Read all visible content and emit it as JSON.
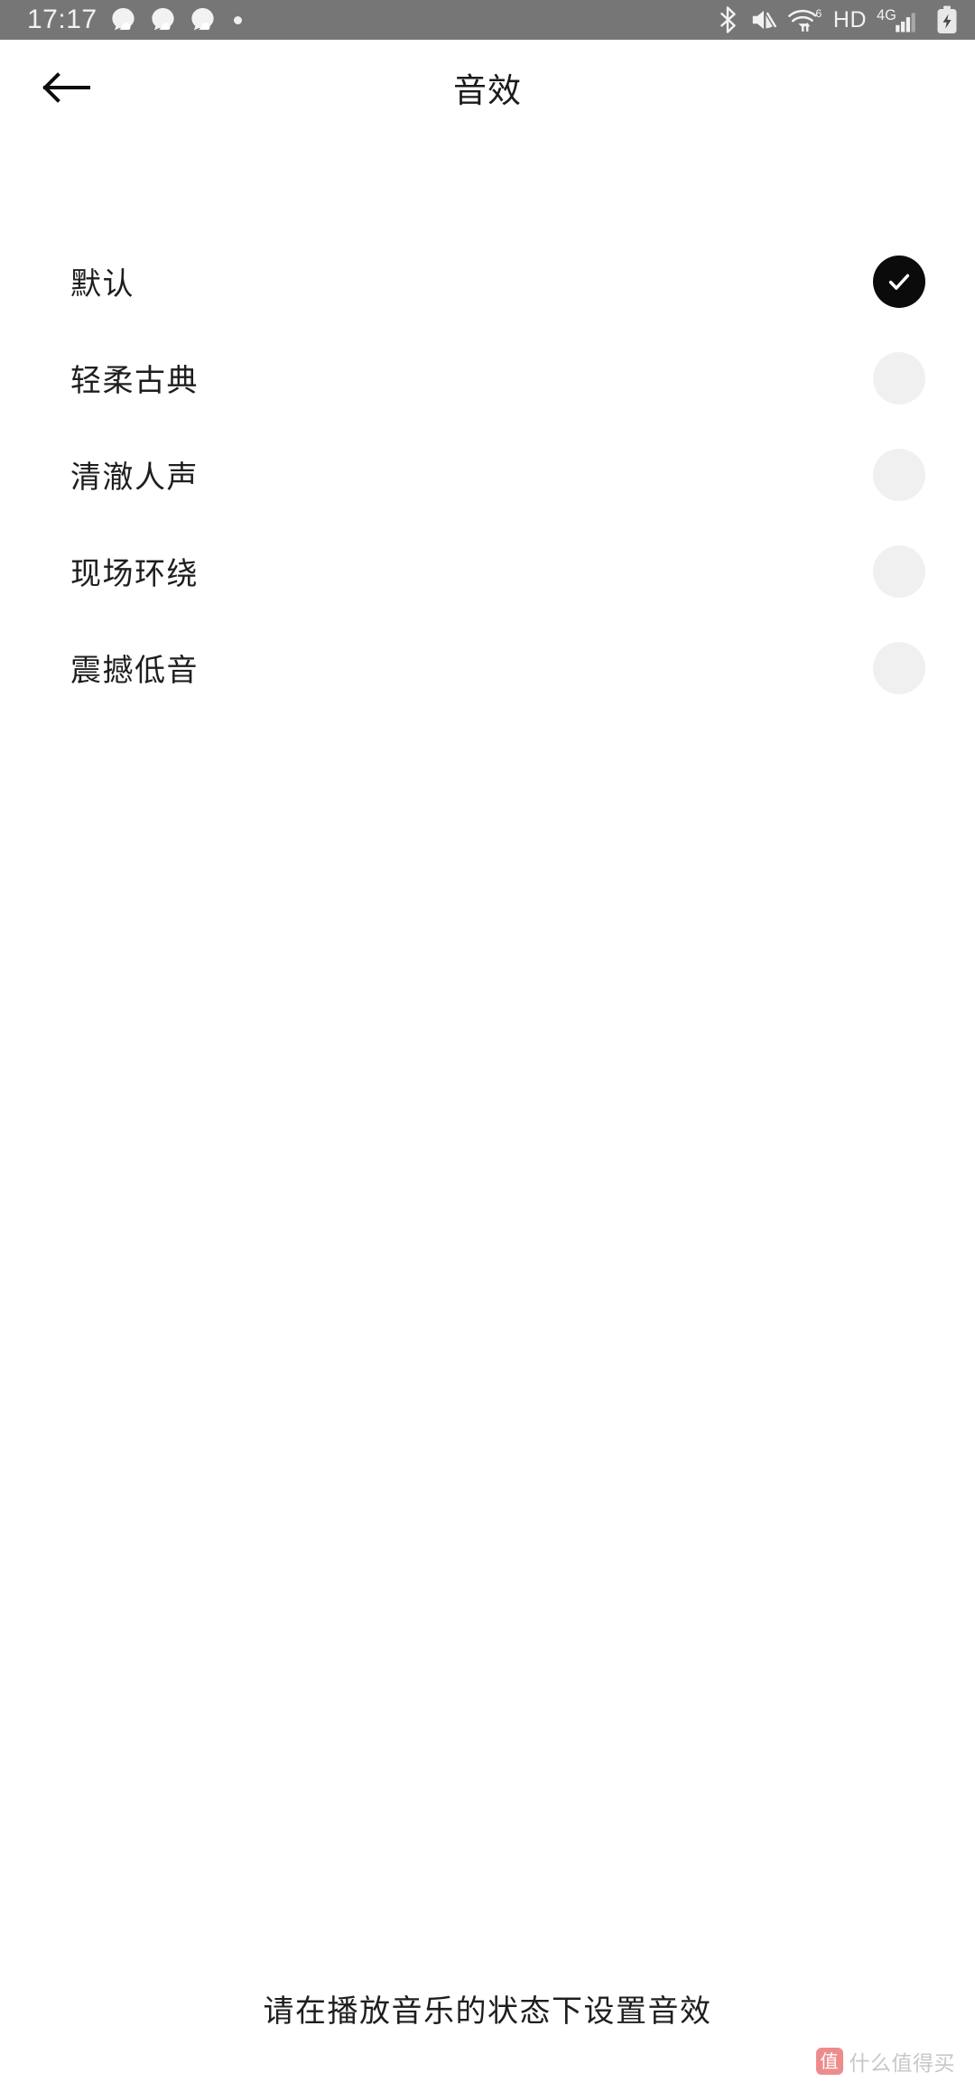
{
  "statusbar": {
    "time": "17:17",
    "left_icons": [
      "qq-bubble-icon",
      "qq-bubble-icon",
      "qq-bubble-icon",
      "dot-indicator-icon"
    ],
    "right_icons": [
      "bluetooth-icon",
      "volume-muted-icon",
      "wifi-6-icon",
      "hd-icon",
      "4g-signal-icon",
      "battery-charging-icon"
    ],
    "wifi_label": "6",
    "hd_label": "HD",
    "network_label": "4G",
    "background_color": "#767676",
    "foreground_color": "#f2f2f2"
  },
  "header": {
    "back_icon": "arrow-left-icon",
    "title": "音效"
  },
  "list": {
    "selected_index": 0,
    "selected_color": "#0b0b0b",
    "unselected_color": "#f0f0f0",
    "items": [
      {
        "label": "默认",
        "selected": true
      },
      {
        "label": "轻柔古典",
        "selected": false
      },
      {
        "label": "清澈人声",
        "selected": false
      },
      {
        "label": "现场环绕",
        "selected": false
      },
      {
        "label": "震撼低音",
        "selected": false
      }
    ]
  },
  "footer": {
    "hint": "请在播放音乐的状态下设置音效"
  },
  "watermark": {
    "badge": "值",
    "text": "什么值得买"
  }
}
